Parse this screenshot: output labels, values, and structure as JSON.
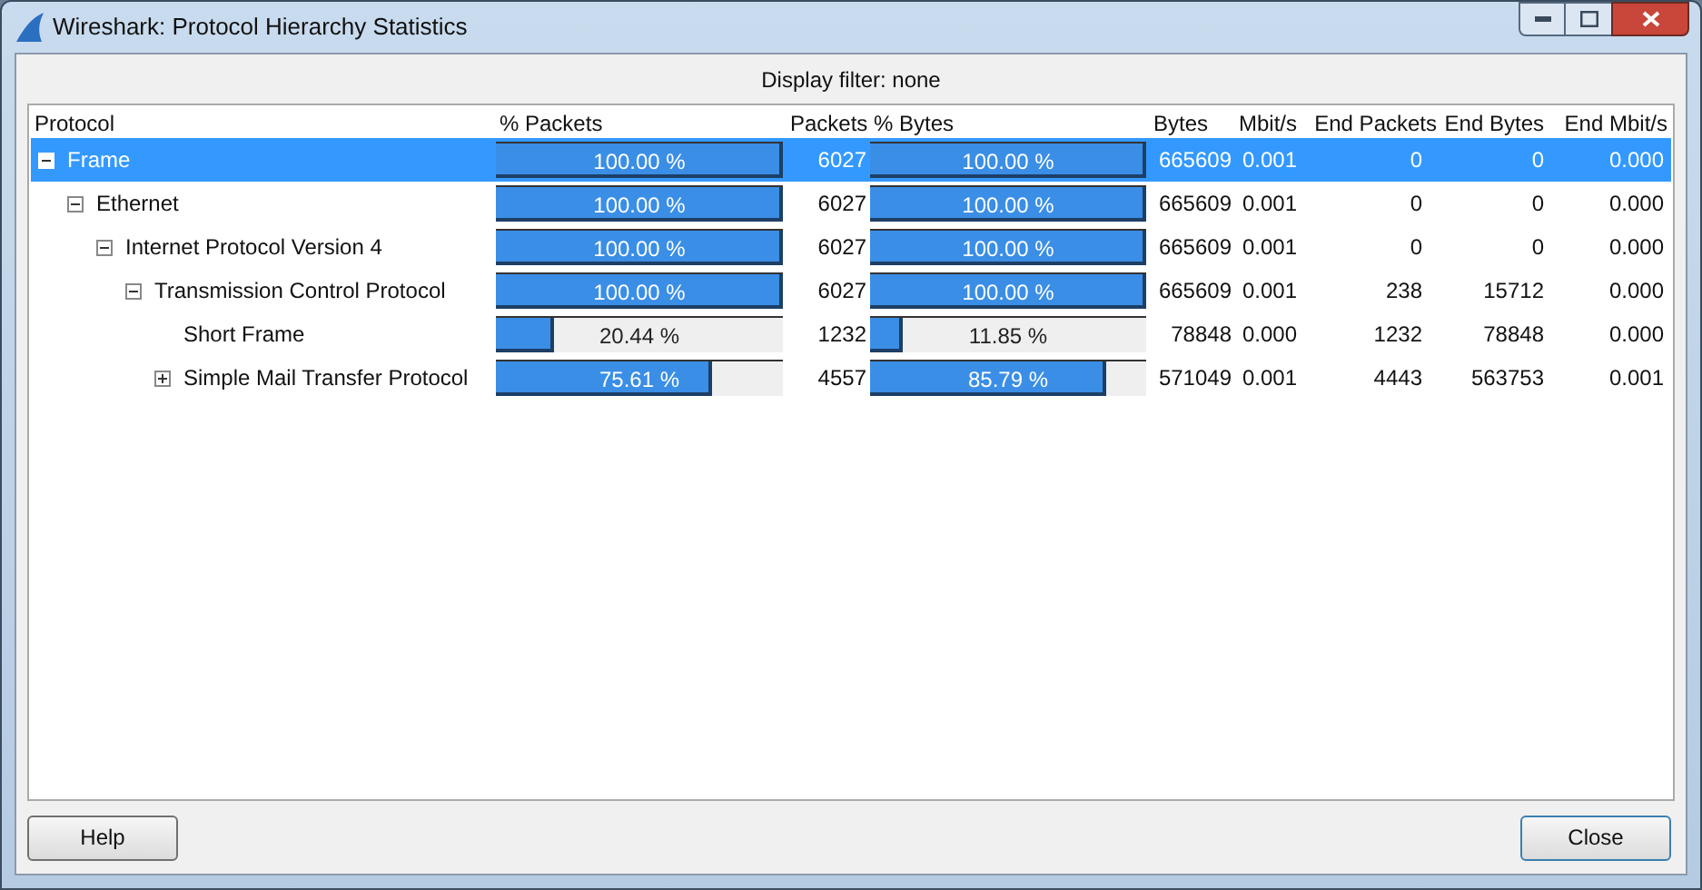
{
  "window": {
    "title": "Wireshark: Protocol Hierarchy Statistics"
  },
  "display_filter": "Display filter: none",
  "table": {
    "columns": [
      "Protocol",
      "% Packets",
      "Packets",
      "% Bytes",
      "Bytes",
      "Mbit/s",
      "End Packets",
      "End Bytes",
      "End Mbit/s"
    ],
    "rows": [
      {
        "protocol": "Frame",
        "expanded": true,
        "selected": true,
        "packets_bar": {
          "level": 1,
          "reading": "100.00 %"
        },
        "packets": "6027",
        "bytes_bar": {
          "level": 1,
          "reading": "100.00 %"
        },
        "bytes": "665609",
        "mbits": "0.001",
        "end_packets": "0",
        "end_bytes": "0",
        "end_mbits": "0.000",
        "children": [
          {
            "protocol": "Ethernet",
            "expanded": true,
            "selected": false,
            "packets_bar": {
              "level": 1,
              "reading": "100.00 %"
            },
            "packets": "6027",
            "bytes_bar": {
              "level": 1,
              "reading": "100.00 %"
            },
            "bytes": "665609",
            "mbits": "0.001",
            "end_packets": "0",
            "end_bytes": "0",
            "end_mbits": "0.000",
            "children": [
              {
                "protocol": "Internet Protocol Version 4",
                "expanded": true,
                "selected": false,
                "packets_bar": {
                  "level": 1,
                  "reading": "100.00 %"
                },
                "packets": "6027",
                "bytes_bar": {
                  "level": 1,
                  "reading": "100.00 %"
                },
                "bytes": "665609",
                "mbits": "0.001",
                "end_packets": "0",
                "end_bytes": "0",
                "end_mbits": "0.000",
                "children": [
                  {
                    "protocol": "Transmission Control Protocol",
                    "expanded": true,
                    "selected": false,
                    "packets_bar": {
                      "level": 1,
                      "reading": "100.00 %"
                    },
                    "packets": "6027",
                    "bytes_bar": {
                      "level": 1,
                      "reading": "100.00 %"
                    },
                    "bytes": "665609",
                    "mbits": "0.001",
                    "end_packets": "238",
                    "end_bytes": "15712",
                    "end_mbits": "0.000",
                    "children": [
                      {
                        "protocol": "Short Frame",
                        "selected": false,
                        "packets_bar": {
                          "level": 0.2044,
                          "reading": "20.44 %"
                        },
                        "packets": "1232",
                        "bytes_bar": {
                          "level": 0.1185,
                          "reading": "11.85 %"
                        },
                        "bytes": "78848",
                        "mbits": "0.000",
                        "end_packets": "1232",
                        "end_bytes": "78848",
                        "end_mbits": "0.000"
                      },
                      {
                        "protocol": "Simple Mail Transfer Protocol",
                        "expanded": false,
                        "selected": false,
                        "packets_bar": {
                          "level": 0.7561,
                          "reading": "75.61 %"
                        },
                        "packets": "4557",
                        "bytes_bar": {
                          "level": 0.8579,
                          "reading": "85.79 %"
                        },
                        "bytes": "571049",
                        "mbits": "0.001",
                        "end_packets": "4443",
                        "end_bytes": "563753",
                        "end_mbits": "0.001"
                      }
                    ]
                  }
                ]
              }
            ]
          }
        ]
      }
    ]
  },
  "buttons": [
    "Help",
    "Close"
  ]
}
